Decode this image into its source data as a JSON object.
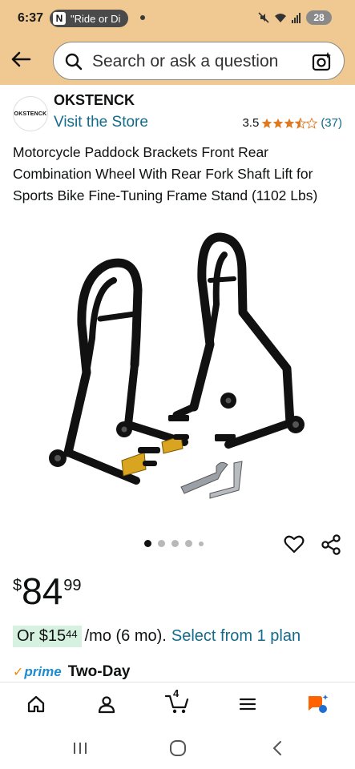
{
  "status_bar": {
    "time": "6:37",
    "notification_app": "N",
    "notification_text": "\"Ride or Di",
    "battery": "28"
  },
  "search": {
    "placeholder": "Search or ask a question"
  },
  "brand": {
    "logo_text": "OKSTENCK",
    "name": "OKSTENCK",
    "visit_store": "Visit the Store"
  },
  "rating": {
    "value": "3.5",
    "stars": 3.5,
    "count": "(37)"
  },
  "product": {
    "title": "Motorcycle Paddock Brackets Front Rear Combination Wheel With Rear Fork Shaft Lift for Sports Bike Fine-Tuning Frame Stand (1102 Lbs)",
    "image_count": 5,
    "active_image": 1
  },
  "price": {
    "symbol": "$",
    "whole": "84",
    "fraction": "99"
  },
  "installment": {
    "prefix": "Or $15",
    "cents": "44",
    "terms": "/mo (6 mo).",
    "plan_link": "Select from 1 plan"
  },
  "delivery": {
    "prime_check": "✓",
    "prime_label": "prime",
    "speed": "Two-Day"
  },
  "nav": {
    "cart_count": "4"
  },
  "colors": {
    "header_bg": "#f0c892",
    "link": "#136b8c",
    "star": "#de7921",
    "installment_bg": "#d7f1e0",
    "prime_blue": "#1f8bd1",
    "prime_check": "#f08804"
  }
}
